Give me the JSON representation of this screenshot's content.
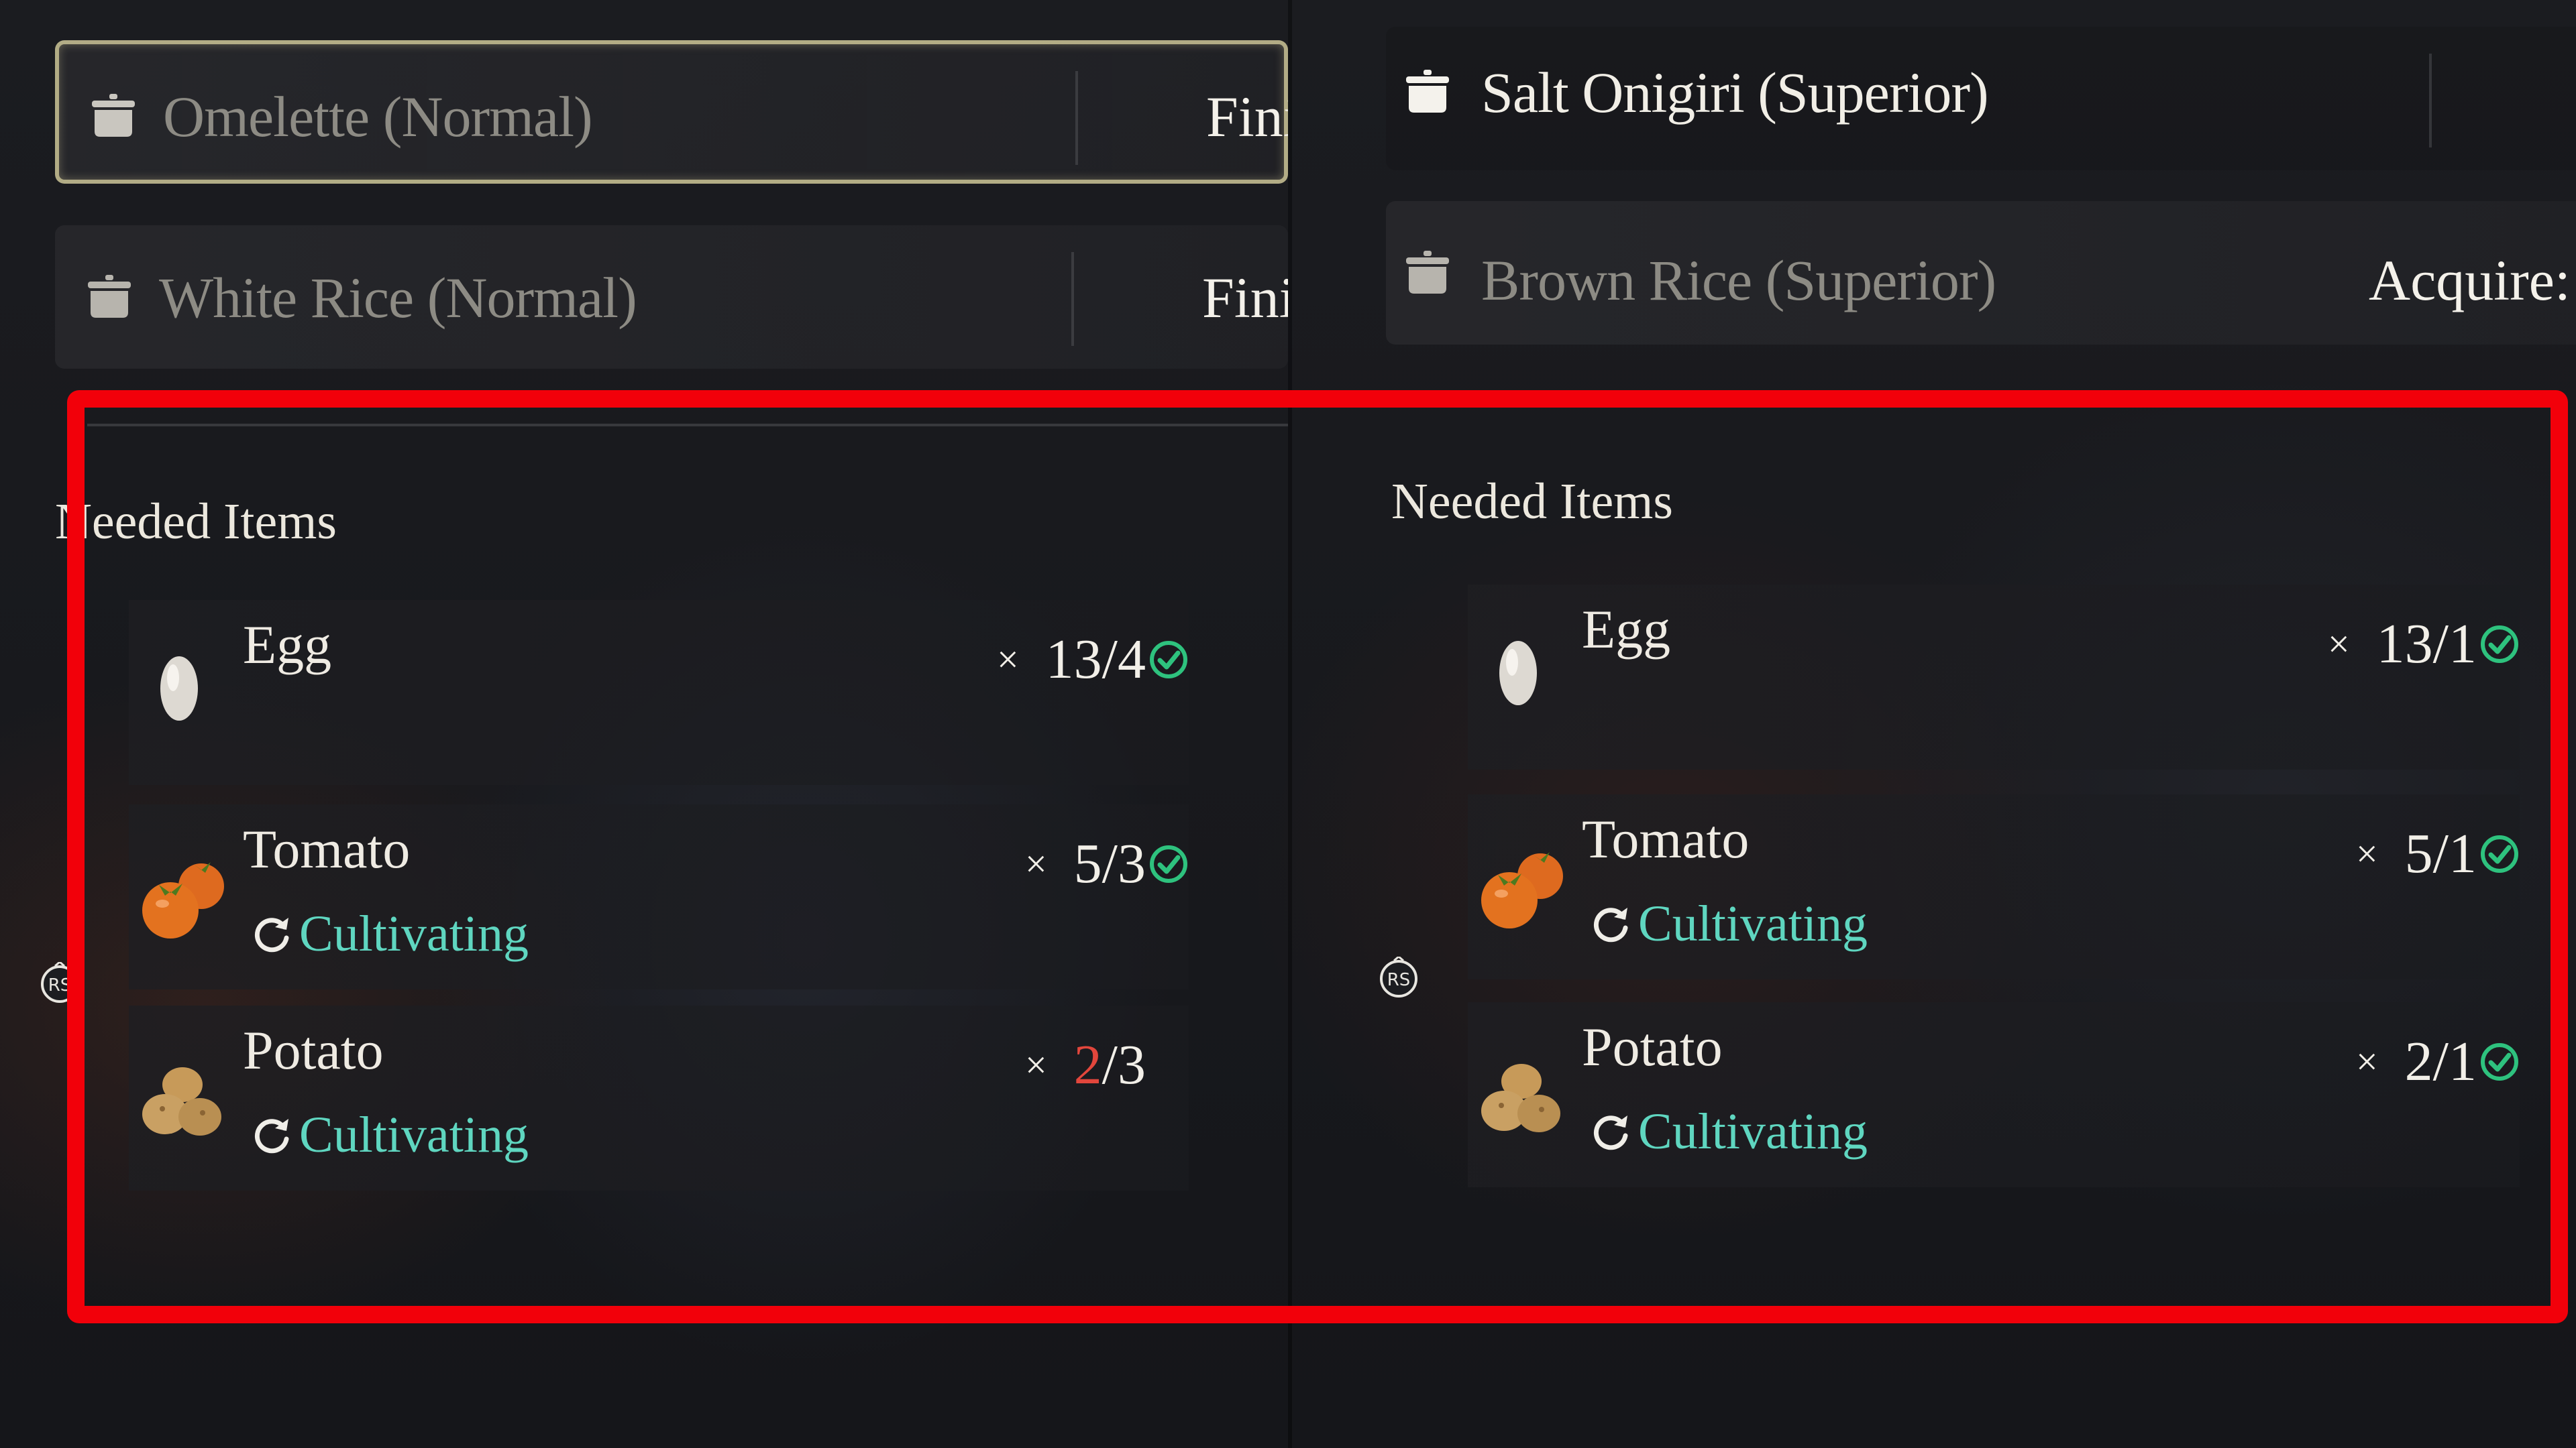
{
  "left_panel": {
    "recipes": [
      {
        "name": "Omelette (Normal)",
        "status": "Finis",
        "selected": true
      },
      {
        "name": "White Rice (Normal)",
        "status": "Finis",
        "selected": false
      }
    ],
    "needed_items_title": "Needed Items",
    "items": [
      {
        "name": "Egg",
        "have": "13",
        "need": "4",
        "have_insufficient": false,
        "complete": true
      },
      {
        "name": "Tomato",
        "status": "Cultivating",
        "have": "5",
        "need": "3",
        "have_insufficient": false,
        "complete": true
      },
      {
        "name": "Potato",
        "status": "Cultivating",
        "have": "2",
        "need": "3",
        "have_insufficient": true,
        "complete": false
      }
    ]
  },
  "right_panel": {
    "recipes": [
      {
        "name": "Salt Onigiri (Superior)",
        "status": "",
        "selected": false
      },
      {
        "name": "Brown Rice (Superior)",
        "status": "Acquire: R",
        "selected": false
      }
    ],
    "needed_items_title": "Needed Items",
    "items": [
      {
        "name": "Egg",
        "have": "13",
        "need": "1",
        "have_insufficient": false,
        "complete": true
      },
      {
        "name": "Tomato",
        "status": "Cultivating",
        "have": "5",
        "need": "1",
        "have_insufficient": false,
        "complete": true
      },
      {
        "name": "Potato",
        "status": "Cultivating",
        "have": "2",
        "need": "1",
        "have_insufficient": false,
        "complete": true
      }
    ]
  },
  "common": {
    "qty_multiplier": "×",
    "qty_separator": "/",
    "rs_button_label": "RS"
  },
  "colors": {
    "cultivating": "#5fd6c0",
    "insufficient": "#e2463c",
    "check": "#2ec27e",
    "highlight_border": "#f2000a",
    "selected_border": "#cdc696"
  }
}
